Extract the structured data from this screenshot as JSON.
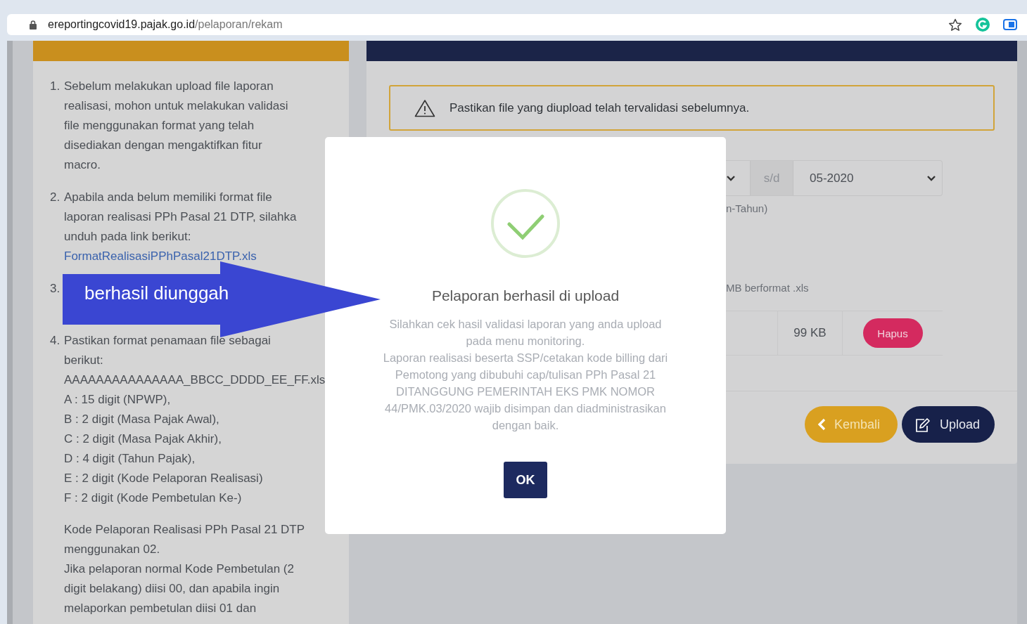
{
  "browser": {
    "url_host": "ereportingcovid19.pajak.go.id",
    "url_path": "/pelaporan/rekam"
  },
  "guide_panel": {
    "items": [
      {
        "number": "1.",
        "text": "Sebelum melakukan upload file laporan\nrealisasi, mohon untuk melakukan validasi\nfile menggunakan format yang telah\ndisediakan dengan mengaktifkan fitur\nmacro."
      },
      {
        "number": "2.",
        "text": "Apabila anda belum memiliki format file\nlaporan realisasi PPh Pasal 21 DTP, silahka\nunduh pada link berikut:",
        "link": "FormatRealisasiPPhPasal21DTP.xls"
      },
      {
        "number": "3."
      },
      {
        "number": "4.",
        "text": "Pastikan format penamaan file sebagai\nberikut:\nAAAAAAAAAAAAAAA_BBCC_DDDD_EE_FF.xls\nA : 15 digit (NPWP),\nB : 2 digit (Masa Pajak Awal),\nC : 2 digit (Masa Pajak Akhir),\nD : 4 digit (Tahun Pajak),\nE : 2 digit (Kode Pelaporan Realisasi)\nF : 2 digit (Kode Pembetulan Ke-)"
      }
    ],
    "note": "Kode Pelaporan Realisasi PPh Pasal 21 DTP\nmenggunakan 02.\nJika pelaporan normal Kode Pembetulan (2\ndigit belakang) diisi 00, dan apabila ingin\nmelaporkan pembetulan diisi 01 dan"
  },
  "report_card": {
    "alert": "Pastikan file yang diupload telah tervalidasi sebelumnya.",
    "period": {
      "separator": "s/d",
      "end_value": "05-2020"
    },
    "period_hint": "n-Tahun)",
    "file_hint": "MB berformat .xls",
    "file_row": {
      "size": "99 KB",
      "delete_label": "Hapus"
    },
    "buttons": [
      {
        "kind": "back",
        "label": "Kembali"
      },
      {
        "kind": "upload",
        "label": "Upload"
      }
    ]
  },
  "dialog": {
    "title": "Pelaporan berhasil di upload",
    "message": "Silahkan cek hasil validasi laporan yang anda upload\npada menu monitoring.\nLaporan realisasi beserta SSP/cetakan kode billing dari\nPemotong yang dibubuhi cap/tulisan PPh Pasal 21\nDITANGGUNG PEMERINTAH EKS PMK NOMOR\n44/PMK.03/2020 wajib disimpan dan diadministrasikan\ndengan baik.",
    "confirm_label": "OK"
  },
  "annotation": {
    "label": "berhasil diunggah"
  }
}
